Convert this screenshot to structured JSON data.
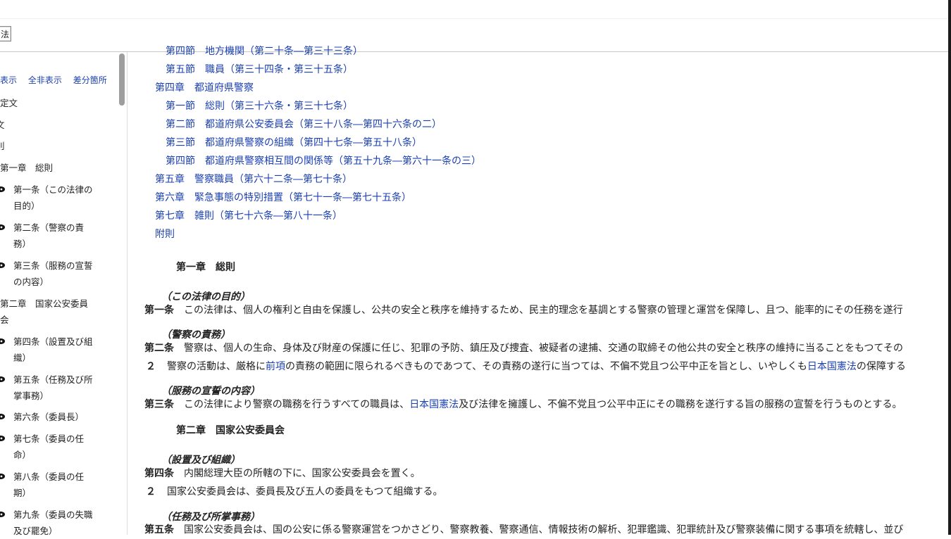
{
  "topbar": {
    "law_tab": "法"
  },
  "sidebar": {
    "toggles": [
      "表示",
      "全非表示",
      "差分箇所"
    ],
    "items": [
      "定文",
      "文",
      "則",
      "第一章　総則"
    ],
    "articles": [
      {
        "line1": "第一条（この法律の",
        "line2": "目的）"
      },
      {
        "line1": "第二条（警察の責",
        "line2": "務）"
      },
      {
        "line1": "第三条（服務の宣誓",
        "line2": "の内容）"
      }
    ],
    "chapter2_line1": "第二章　国家公安委員",
    "chapter2_line2": "会",
    "articles2": [
      {
        "line1": "第四条（設置及び組",
        "line2": "織）"
      },
      {
        "line1": "第五条（任務及び所",
        "line2": "掌事務）"
      },
      {
        "line1": "第六条（委員長）",
        "line2": ""
      },
      {
        "line1": "第七条（委員の任",
        "line2": "命）"
      },
      {
        "line1": "第八条（委員の任",
        "line2": "期）"
      },
      {
        "line1": "第九条（委員の失職",
        "line2": "及び罷免）"
      }
    ]
  },
  "toc": [
    "第四節　地方機関（第二十条―第三十三条）",
    "第五節　職員（第三十四条・第三十五条）",
    "第四章　都道府県警察",
    "第一節　総則（第三十六条・第三十七条）",
    "第二節　都道府県公安委員会（第三十八条―第四十六条の二）",
    "第三節　都道府県警察の組織（第四十七条―第五十八条）",
    "第四節　都道府県警察相互間の関係等（第五十九条―第六十一条の三）",
    "第五章　警察職員（第六十二条―第七十条）",
    "第六章　緊急事態の特別措置（第七十一条―第七十五条）",
    "第七章　雑則（第七十六条―第八十一条）",
    "附則"
  ],
  "body": {
    "chapter1": "第一章　総則",
    "cap1": "（この法律の目的）",
    "art1_num": "第一条",
    "art1_text": "この法律は、個人の権利と自由を保護し、公共の安全と秩序を維持するため、民主的理念を基調とする警察の管理と運営を保障し、且つ、能率的にその任務を遂行",
    "cap2": "（警察の責務）",
    "art2_num": "第二条",
    "art2_text": "警察は、個人の生命、身体及び財産の保護に任じ、犯罪の予防、鎮圧及び捜査、被疑者の逮捕、交通の取締その他公共の安全と秩序の維持に当ることをもつてその",
    "para2_num": "２",
    "para2_a": "警察の活動は、厳格に",
    "para2_link1": "前項",
    "para2_b": "の責務の範囲に限られるべきものであつて、その責務の遂行に当つては、不偏不党且つ公平中正を旨とし、いやしくも",
    "para2_link2": "日本国憲法",
    "para2_c": "の保障する",
    "cap3": "（服務の宣誓の内容）",
    "art3_num": "第三条",
    "art3_a": "この法律により警察の職務を行うすべての職員は、",
    "art3_link": "日本国憲法",
    "art3_b": "及び法律を擁護し、不偏不党且つ公平中正にその職務を遂行する旨の服務の宣誓を行うものとする。",
    "chapter2": "第二章　国家公安委員会",
    "cap4": "（設置及び組織）",
    "art4_num": "第四条",
    "art4_text": "内閣総理大臣の所轄の下に、国家公安委員会を置く。",
    "para4_num": "２",
    "para4_text": "国家公安委員会は、委員長及び五人の委員をもつて組織する。",
    "cap5": "（任務及び所掌事務）",
    "art5_num": "第五条",
    "art5_text": "国家公安委員会は、国の公安に係る警察運営をつかさどり、警察教養、警察通信、情報技術の解析、犯罪鑑識、犯罪統計及び警察装備に関する事項を統轄し、並び"
  }
}
